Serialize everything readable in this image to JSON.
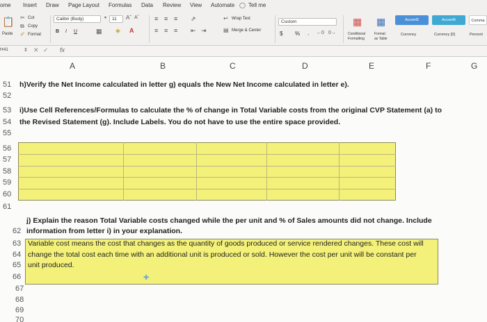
{
  "tabs": [
    "ome",
    "Insert",
    "Draw",
    "Page Layout",
    "Formulas",
    "Data",
    "Review",
    "View",
    "Automate",
    "Tell me"
  ],
  "clipboard": {
    "cut": "Cut",
    "copy": "Copy",
    "format": "Format",
    "paste": "Paste"
  },
  "font": {
    "name": "Calibri (Body)",
    "size": "11",
    "bold": "B",
    "italic": "I",
    "underline": "U"
  },
  "alignment": {
    "wrap": "Wrap Text",
    "merge": "Merge & Center"
  },
  "number": {
    "format": "Custom",
    "currency": "$",
    "percent": "%"
  },
  "styles": {
    "conditional": "Conditional\nFormatting",
    "conditional_l1": "Conditional",
    "conditional_l2": "Formatting",
    "format_table_l1": "Format",
    "format_table_l2": "as Table",
    "swatches": [
      "Accent5",
      "Accent6",
      "Comma",
      "Currency",
      "Currency [0]",
      "Percent"
    ]
  },
  "formula_bar": {
    "name_box": "H41",
    "fx": "fx",
    "value": ""
  },
  "columns": [
    "A",
    "B",
    "C",
    "D",
    "E",
    "F",
    "G"
  ],
  "rows": {
    "r51": {
      "num": "51",
      "text": "h)Verify the  Net Income calculated in letter g) equals the New Net Income calculated in letter e)."
    },
    "r52": {
      "num": "52"
    },
    "r53": {
      "num": "53",
      "text": "i)Use Cell References/Formulas to calculate the % of change in Total Variable costs from the original CVP Statement (a) to"
    },
    "r54": {
      "num": "54",
      "text": "the Revised Statement (g). Include Labels.  You do not have to use the entire space provided."
    },
    "r55": {
      "num": "55"
    },
    "r56": {
      "num": "56"
    },
    "r57": {
      "num": "57"
    },
    "r58": {
      "num": "58"
    },
    "r59": {
      "num": "59"
    },
    "r60": {
      "num": "60"
    },
    "r61": {
      "num": "61",
      "text": "j) Explain the reason Total Variable costs changed while the per unit and % of Sales amounts did not change.  Include"
    },
    "r62": {
      "num": "62",
      "text": "information from letter i) in your explanation."
    },
    "r63": {
      "num": "63",
      "text": "Variable cost means the cost that changes as the quantity of goods produced or service rendered changes. These cost will"
    },
    "r64": {
      "num": "64",
      "text": "change the total cost each time with an additional unit is produced or sold. However the cost per unit will be constant per"
    },
    "r65": {
      "num": "65",
      "text": "unit produced."
    },
    "r66": {
      "num": "66"
    },
    "r67": {
      "num": "67"
    },
    "r68": {
      "num": "68"
    },
    "r69": {
      "num": "69"
    },
    "r70": {
      "num": "70"
    }
  },
  "colors": {
    "highlight": "#f4f17a",
    "accent5": "#4a90d9",
    "accent6": "#3fa9d4"
  }
}
